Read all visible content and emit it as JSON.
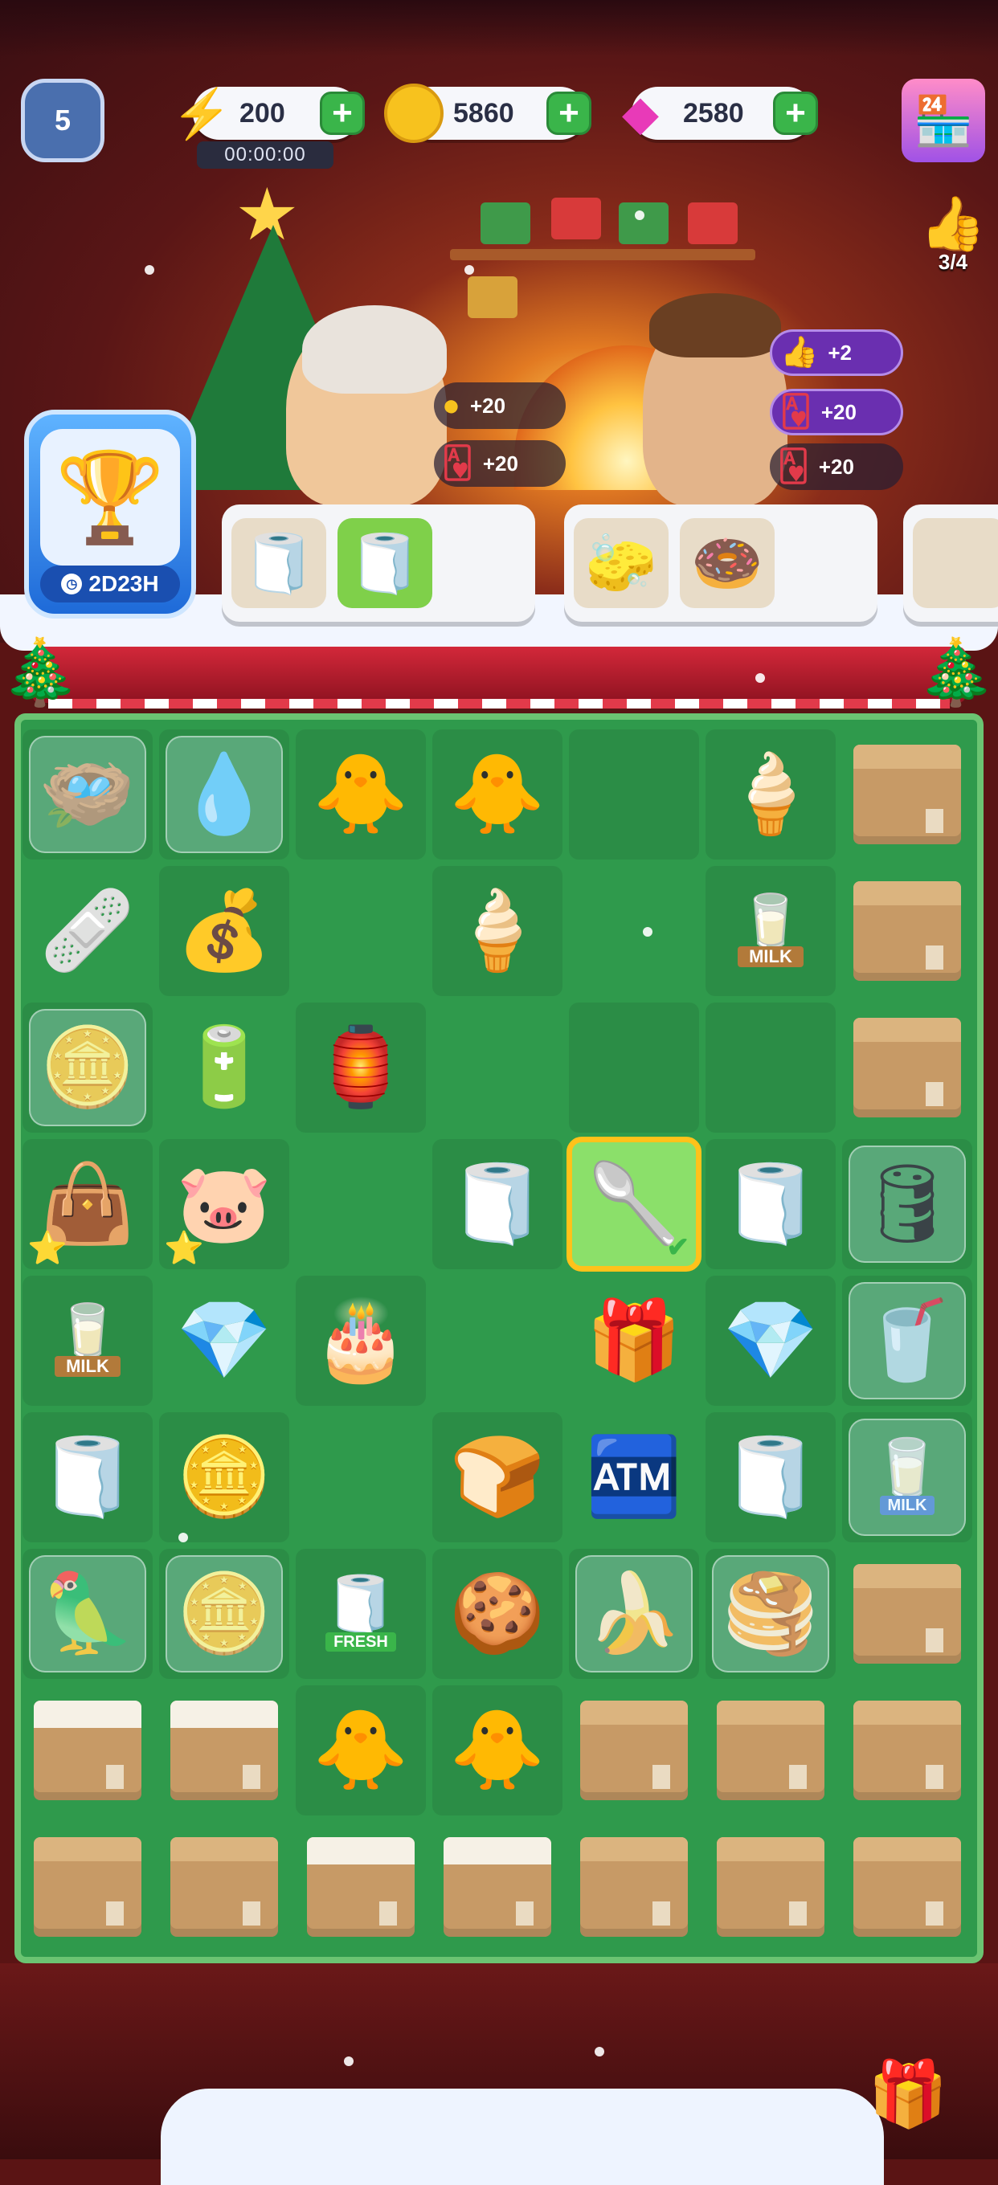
{
  "hud": {
    "level": "5",
    "energy": "200",
    "energy_timer": "00:00:00",
    "coins": "5860",
    "gems": "2580",
    "likes_progress": "3/4"
  },
  "event": {
    "time_left": "2D23H"
  },
  "rewards": {
    "grandma": [
      {
        "icon": "coin-icon",
        "text": "+20"
      },
      {
        "icon": "card-icon",
        "text": "+20"
      }
    ],
    "man": [
      {
        "icon": "thumbs-up-icon",
        "text": "+2"
      },
      {
        "icon": "card-icon",
        "text": "+20"
      },
      {
        "icon": "card-icon",
        "text": "+20"
      }
    ]
  },
  "orders": [
    {
      "items": [
        "green-tissue-stack",
        "fresh-toilet-paper"
      ],
      "done": [
        false,
        true
      ]
    },
    {
      "items": [
        "tissue-box",
        "chocolate-donut"
      ],
      "done": [
        false,
        false
      ]
    }
  ],
  "board": {
    "columns": 7,
    "rows": 9,
    "cells": [
      [
        "wrapped-nest",
        "wrapped-water-drop",
        "chick-nest",
        "chick-nest",
        "empty",
        "ice-cream-cone",
        "cardboard-box"
      ],
      [
        "bandage",
        "coin-chest",
        "empty",
        "ice-cream-cone",
        "empty",
        "milk-crate",
        "cardboard-box"
      ],
      [
        "wrapped-coin",
        "energy-battery",
        "energy-lantern",
        "empty",
        "empty",
        "empty",
        "cardboard-box"
      ],
      [
        "coin-bag",
        "piggy-bank",
        "empty",
        "toilet-paper-rolls",
        "hand-mixer-selected",
        "toilet-paper-rolls",
        "wrapped-milk-tank"
      ],
      [
        "milk-crate",
        "pink-gems",
        "berry-cake",
        "empty",
        "gift-box",
        "pink-gems",
        "wrapped-funnel"
      ],
      [
        "toilet-paper-rolls",
        "gold-coin",
        "empty",
        "bread-bun",
        "cash-register",
        "toilet-paper-roll",
        "wrapped-milk-cartons"
      ],
      [
        "wrapped-cockatiel",
        "wrapped-coin",
        "fresh-toilet-paper",
        "cookies",
        "wrapped-bananas",
        "wrapped-pancakes",
        "cardboard-box"
      ],
      [
        "open-box",
        "open-box",
        "chick-nest",
        "chick-nest",
        "cardboard-box",
        "cardboard-box",
        "cardboard-box"
      ],
      [
        "closed-box",
        "closed-box",
        "open-box",
        "open-box",
        "cardboard-box",
        "cardboard-box",
        "cardboard-box"
      ]
    ],
    "labels": {
      "milk": "MILK",
      "fresh": "FRESH"
    }
  },
  "colors": {
    "board_green": "#2f9a4c",
    "plus_green": "#3ab54a",
    "selection_gold": "#ffc21a",
    "event_blue": "#1e6ad8"
  }
}
